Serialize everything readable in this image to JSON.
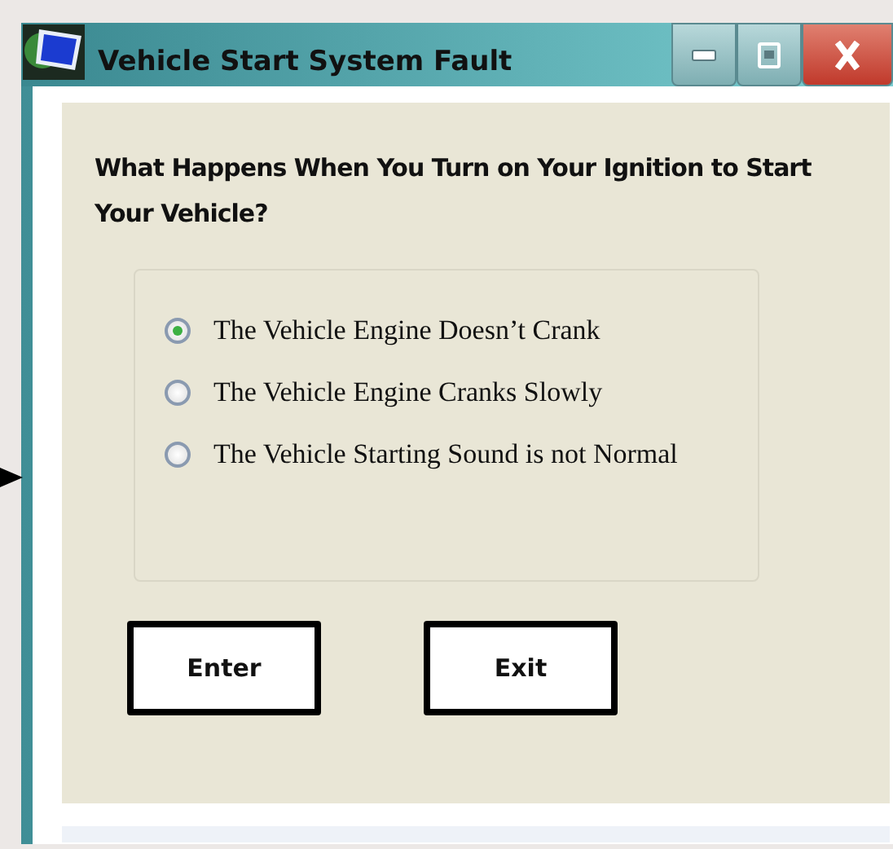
{
  "window": {
    "title": "Vehicle Start System Fault"
  },
  "question": "What Happens When You Turn on Your Ignition to Start Your Vehicle?",
  "options": [
    {
      "label": "The Vehicle Engine Doesn’t Crank",
      "selected": true
    },
    {
      "label": "The Vehicle Engine Cranks Slowly",
      "selected": false
    },
    {
      "label": "The Vehicle Starting Sound is not Normal",
      "selected": false
    }
  ],
  "buttons": [
    "Enter",
    "Exit"
  ]
}
